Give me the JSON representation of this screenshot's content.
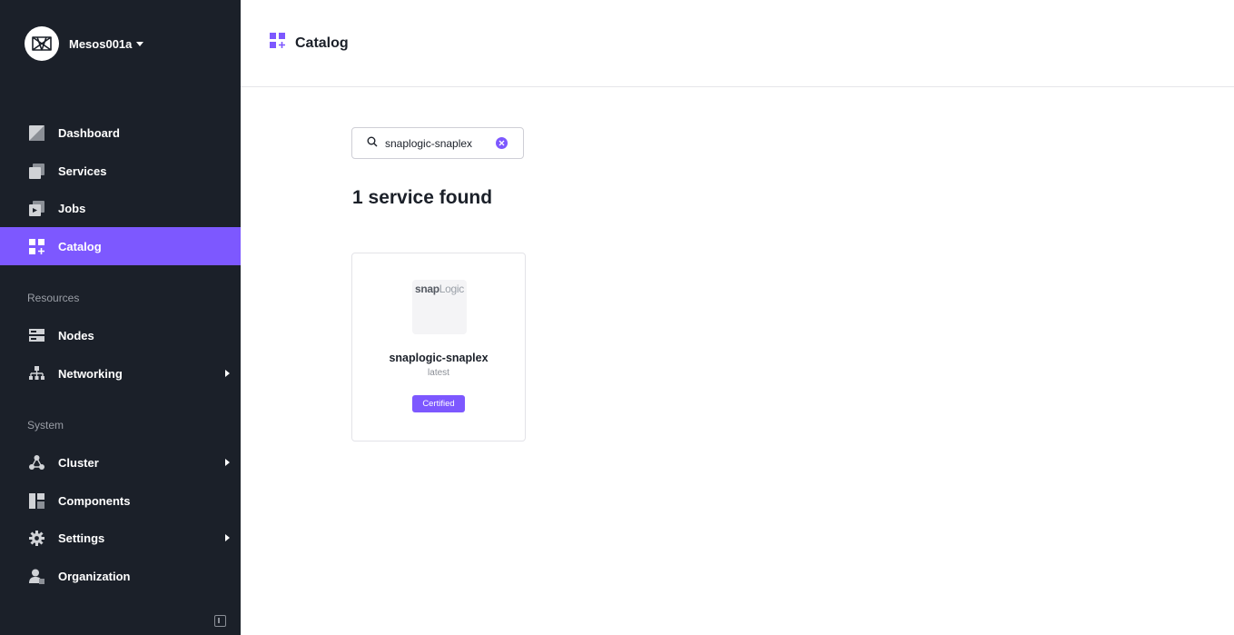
{
  "org": {
    "name": "Mesos001a"
  },
  "nav": {
    "dashboard": "Dashboard",
    "services": "Services",
    "jobs": "Jobs",
    "catalog": "Catalog",
    "resources_label": "Resources",
    "nodes": "Nodes",
    "networking": "Networking",
    "system_label": "System",
    "cluster": "Cluster",
    "components": "Components",
    "settings": "Settings",
    "organization": "Organization"
  },
  "header": {
    "title": "Catalog"
  },
  "search": {
    "value": "snaplogic-snaplex"
  },
  "results": {
    "count_text": "1 service found"
  },
  "cards": [
    {
      "logo_text_a": "snap",
      "logo_text_b": "Logic",
      "name": "snaplogic-snaplex",
      "version": "latest",
      "badge": "Certified"
    }
  ],
  "colors": {
    "sidebar_bg": "#1b2029",
    "accent": "#7d58ff",
    "text_dark": "#1b2029",
    "section_label": "#9a9ea6"
  },
  "icons": {
    "brand": "mesosphere-logo-icon",
    "dashboard": "dashboard-icon",
    "services": "services-icon",
    "jobs": "jobs-icon",
    "catalog": "catalog-icon",
    "nodes": "nodes-icon",
    "networking": "networking-icon",
    "cluster": "cluster-icon",
    "components": "components-icon",
    "settings": "gear-icon",
    "organization": "organization-icon",
    "search": "search-icon",
    "clear": "clear-icon"
  }
}
